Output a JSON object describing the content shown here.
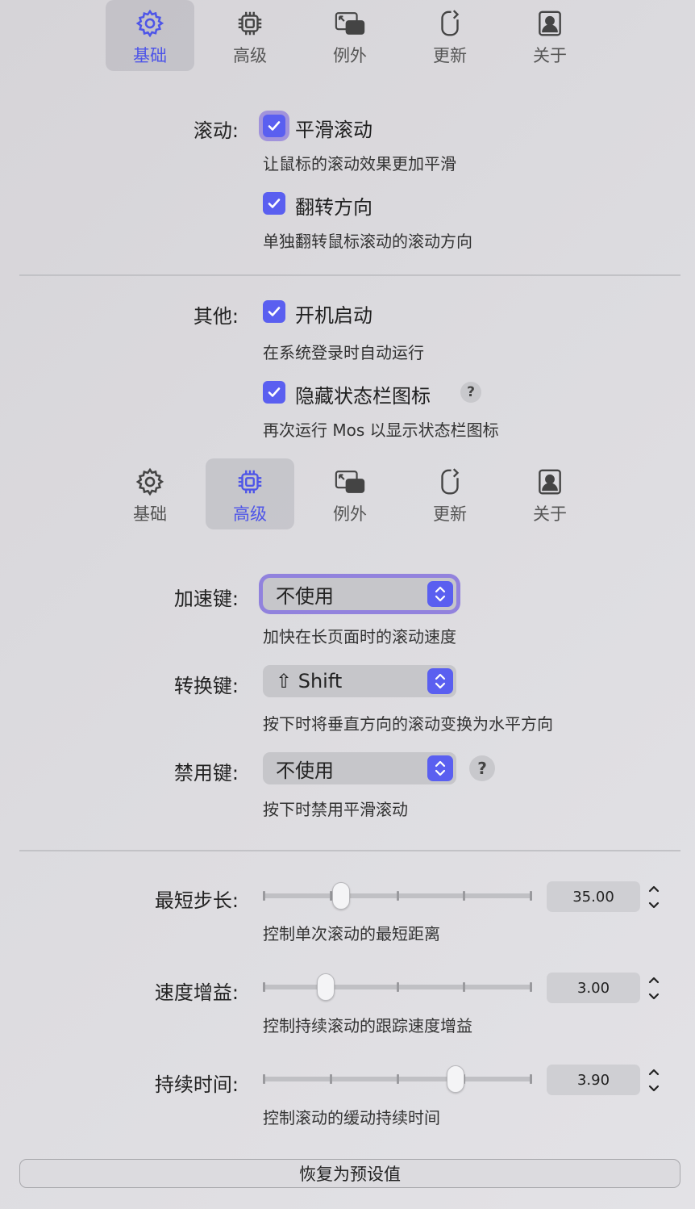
{
  "tabs": [
    {
      "label": "基础",
      "icon": "gear-icon"
    },
    {
      "label": "高级",
      "icon": "cpu-icon"
    },
    {
      "label": "例外",
      "icon": "window-exception-icon"
    },
    {
      "label": "更新",
      "icon": "mouse-refresh-icon"
    },
    {
      "label": "关于",
      "icon": "person-card-icon"
    }
  ],
  "basic": {
    "scroll_label": "滚动:",
    "smooth_label": "平滑滚动",
    "smooth_desc": "让鼠标的滚动效果更加平滑",
    "reverse_label": "翻转方向",
    "reverse_desc": "单独翻转鼠标滚动的滚动方向",
    "other_label": "其他:",
    "launch_label": "开机启动",
    "launch_desc": "在系统登录时自动运行",
    "hide_icon_label": "隐藏状态栏图标",
    "hide_icon_desc": "再次运行 Mos 以显示状态栏图标",
    "help": "?"
  },
  "advanced": {
    "accel_label": "加速键:",
    "accel_value": "不使用",
    "accel_desc": "加快在长页面时的滚动速度",
    "convert_label": "转换键:",
    "convert_value": "⇧ Shift",
    "convert_desc": "按下时将垂直方向的滚动变换为水平方向",
    "disable_label": "禁用键:",
    "disable_value": "不使用",
    "disable_desc": "按下时禁用平滑滚动",
    "help": "?",
    "sliders": [
      {
        "label": "最短步长:",
        "value": "35.00",
        "desc": "控制单次滚动的最短距离",
        "fraction": 0.29
      },
      {
        "label": "速度增益:",
        "value": "3.00",
        "desc": "控制持续滚动的跟踪速度增益",
        "fraction": 0.235
      },
      {
        "label": "持续时间:",
        "value": "3.90",
        "desc": "控制滚动的缓动持续时间",
        "fraction": 0.715
      }
    ],
    "reset_label": "恢复为预设值"
  },
  "colors": {
    "accent": "#5a5ff0",
    "active_tab_text": "#4e55e8"
  }
}
